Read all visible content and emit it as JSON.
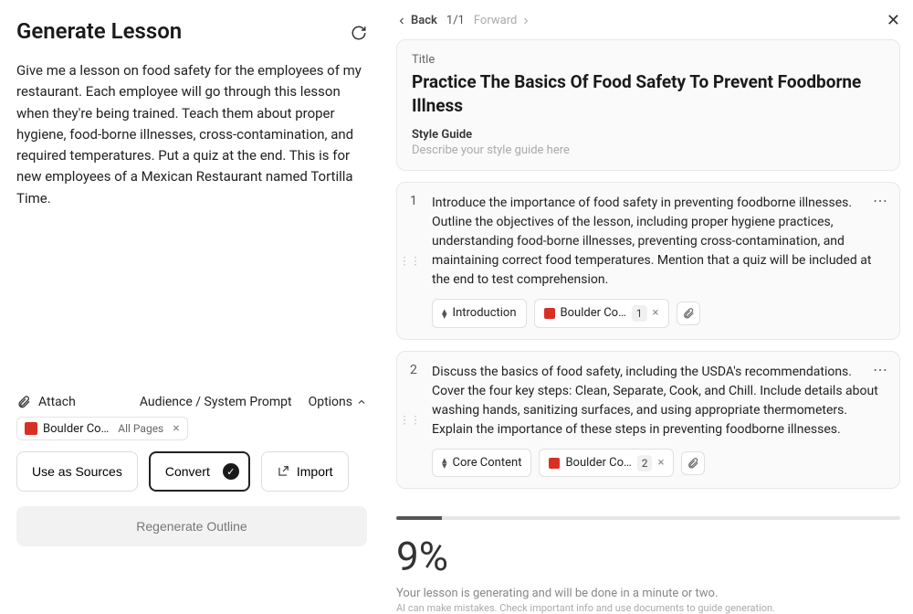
{
  "left": {
    "heading": "Generate Lesson",
    "prompt_text": "Give me a lesson on food safety for the employees of my restaurant. Each employee will go through this lesson when they're being trained. Teach them about proper hygiene, food-borne illnesses, cross-contamination, and required temperatures. Put a quiz at the end. This is for new employees of a Mexican Restaurant named Tortilla Time.",
    "attach_label": "Attach",
    "audience_label": "Audience / System Prompt",
    "options_label": "Options",
    "source": {
      "name": "Boulder Co…",
      "pages": "All Pages"
    },
    "buttons": {
      "use_sources": "Use as Sources",
      "convert": "Convert",
      "import": "Import",
      "regenerate": "Regenerate Outline"
    }
  },
  "right": {
    "nav": {
      "back": "Back",
      "counter": "1/1",
      "forward": "Forward"
    },
    "title_panel": {
      "label": "Title",
      "title": "Practice The Basics Of Food Safety To Prevent Foodborne Illness",
      "style_label": "Style Guide",
      "style_placeholder": "Describe your style guide here"
    },
    "outline": [
      {
        "num": "1",
        "text": "Introduce the importance of food safety in preventing foodborne illnesses. Outline the objectives of the lesson, including proper hygiene practices, understanding food-borne illnesses, preventing cross-contamination, and maintaining correct food temperatures. Mention that a quiz will be included at the end to test comprehension.",
        "type_tag": "Introduction",
        "doc_tag": "Boulder Co…",
        "doc_count": "1"
      },
      {
        "num": "2",
        "text": "Discuss the basics of food safety, including the USDA's recommendations. Cover the four key steps: Clean, Separate, Cook, and Chill. Include details about washing hands, sanitizing surfaces, and using appropriate thermometers. Explain the importance of these steps in preventing foodborne illnesses.",
        "type_tag": "Core Content",
        "doc_tag": "Boulder Co…",
        "doc_count": "2"
      }
    ],
    "progress": {
      "percent_value": 9,
      "percent_label": "9%",
      "message": "Your lesson is generating and will be done in a minute or two.",
      "disclaimer": "AI can make mistakes. Check important info and use documents to guide generation."
    }
  }
}
